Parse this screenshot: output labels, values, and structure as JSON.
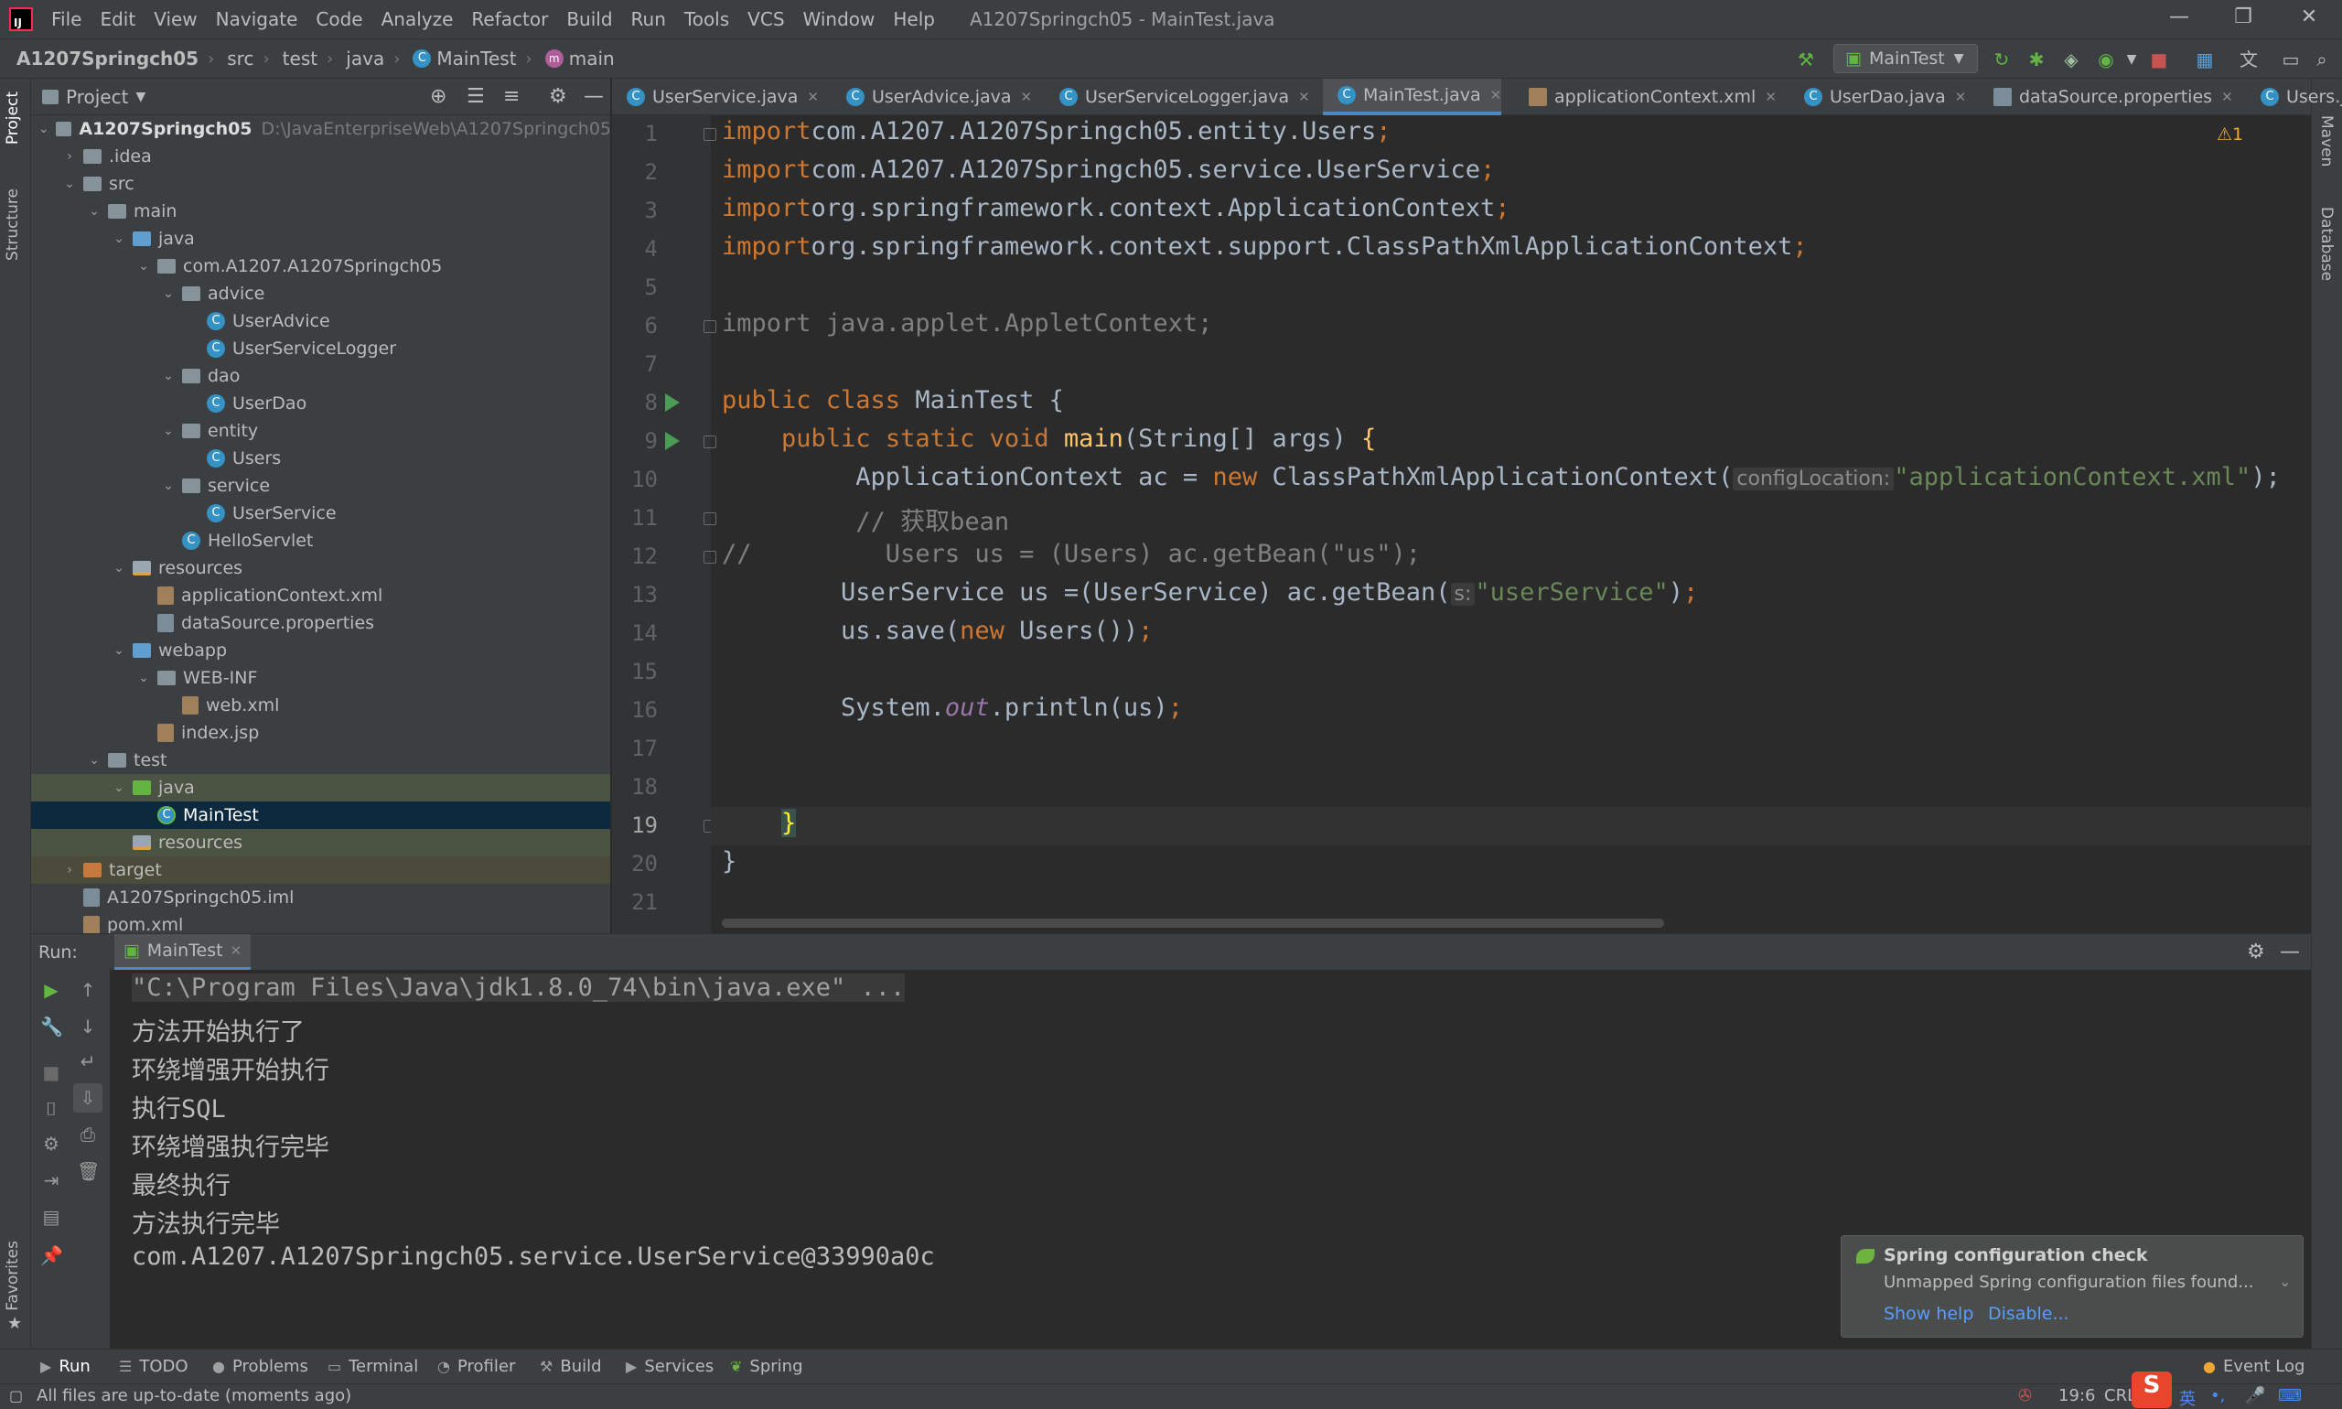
{
  "window": {
    "title": "A1207Springch05 - MainTest.java",
    "menus": [
      "File",
      "Edit",
      "View",
      "Navigate",
      "Code",
      "Analyze",
      "Refactor",
      "Build",
      "Run",
      "Tools",
      "VCS",
      "Window",
      "Help"
    ],
    "controls": {
      "minimize": "—",
      "maximize": "❐",
      "close": "✕"
    }
  },
  "breadcrumb": {
    "project": "A1207Springch05",
    "parts": [
      "src",
      "test",
      "java"
    ],
    "class": "MainTest",
    "method": "main"
  },
  "toolbar": {
    "run_config": "MainTest",
    "icons": [
      "hammer-icon",
      "run-icon",
      "debug-icon",
      "coverage-icon",
      "profile-icon",
      "stop-icon",
      "project-structure-icon",
      "translate-icon",
      "layout-icon",
      "search-icon"
    ]
  },
  "side_tabs": {
    "project": "Project",
    "structure": "Structure",
    "favorites": "Favorites",
    "maven": "Maven",
    "database": "Database"
  },
  "project": {
    "header": "Project",
    "root_name": "A1207Springch05",
    "root_path": "D:\\JavaEnterpriseWeb\\A1207Springch05",
    "tree": [
      {
        "label": ".idea",
        "depth": 1,
        "kind": "folder",
        "arrow": "›"
      },
      {
        "label": "src",
        "depth": 1,
        "kind": "folder",
        "arrow": "⌄"
      },
      {
        "label": "main",
        "depth": 2,
        "kind": "folder",
        "arrow": "⌄"
      },
      {
        "label": "java",
        "depth": 3,
        "kind": "folder-blue",
        "arrow": "⌄"
      },
      {
        "label": "com.A1207.A1207Springch05",
        "depth": 4,
        "kind": "folder",
        "arrow": "⌄"
      },
      {
        "label": "advice",
        "depth": 5,
        "kind": "folder",
        "arrow": "⌄"
      },
      {
        "label": "UserAdvice",
        "depth": 6,
        "kind": "class",
        "arrow": ""
      },
      {
        "label": "UserServiceLogger",
        "depth": 6,
        "kind": "class",
        "arrow": ""
      },
      {
        "label": "dao",
        "depth": 5,
        "kind": "folder",
        "arrow": "⌄"
      },
      {
        "label": "UserDao",
        "depth": 6,
        "kind": "class",
        "arrow": ""
      },
      {
        "label": "entity",
        "depth": 5,
        "kind": "folder",
        "arrow": "⌄"
      },
      {
        "label": "Users",
        "depth": 6,
        "kind": "class",
        "arrow": ""
      },
      {
        "label": "service",
        "depth": 5,
        "kind": "folder",
        "arrow": "⌄"
      },
      {
        "label": "UserService",
        "depth": 6,
        "kind": "class",
        "arrow": ""
      },
      {
        "label": "HelloServlet",
        "depth": 5,
        "kind": "class",
        "arrow": ""
      },
      {
        "label": "resources",
        "depth": 3,
        "kind": "folder-res",
        "arrow": "⌄"
      },
      {
        "label": "applicationContext.xml",
        "depth": 4,
        "kind": "xml",
        "arrow": ""
      },
      {
        "label": "dataSource.properties",
        "depth": 4,
        "kind": "prop",
        "arrow": ""
      },
      {
        "label": "webapp",
        "depth": 3,
        "kind": "folder-blue",
        "arrow": "⌄"
      },
      {
        "label": "WEB-INF",
        "depth": 4,
        "kind": "folder",
        "arrow": "⌄"
      },
      {
        "label": "web.xml",
        "depth": 5,
        "kind": "xml",
        "arrow": ""
      },
      {
        "label": "index.jsp",
        "depth": 4,
        "kind": "xml",
        "arrow": ""
      },
      {
        "label": "test",
        "depth": 2,
        "kind": "folder",
        "arrow": "⌄"
      },
      {
        "label": "java",
        "depth": 3,
        "kind": "folder-green",
        "arrow": "⌄"
      },
      {
        "label": "MainTest",
        "depth": 4,
        "kind": "class-test",
        "arrow": ""
      },
      {
        "label": "resources",
        "depth": 3,
        "kind": "folder-res",
        "arrow": ""
      },
      {
        "label": "target",
        "depth": 1,
        "kind": "folder-orange",
        "arrow": "›"
      },
      {
        "label": "A1207Springch05.iml",
        "depth": 1,
        "kind": "prop",
        "arrow": ""
      },
      {
        "label": "pom.xml",
        "depth": 1,
        "kind": "xml",
        "arrow": ""
      }
    ]
  },
  "tabs": [
    {
      "label": "UserService.java",
      "kind": "class"
    },
    {
      "label": "UserAdvice.java",
      "kind": "class"
    },
    {
      "label": "UserServiceLogger.java",
      "kind": "class"
    },
    {
      "label": "MainTest.java",
      "kind": "class"
    },
    {
      "label": "applicationContext.xml",
      "kind": "xml"
    },
    {
      "label": "UserDao.java",
      "kind": "class"
    },
    {
      "label": "dataSource.properties",
      "kind": "prop"
    },
    {
      "label": "Users.java",
      "kind": "class"
    }
  ],
  "editor": {
    "warnings": "⚠1",
    "current_line": 19,
    "lines": [
      [
        [
          "kw",
          "import"
        ],
        [
          "",
          "com.A1207.A1207Springch05.entity.Users"
        ],
        [
          "kw",
          ";"
        ]
      ],
      [
        [
          "kw",
          "import"
        ],
        [
          "",
          "com.A1207.A1207Springch05.service.UserService"
        ],
        [
          "kw",
          ";"
        ]
      ],
      [
        [
          "kw",
          "import"
        ],
        [
          "",
          "org.springframework.context.ApplicationContext"
        ],
        [
          "kw",
          ";"
        ]
      ],
      [
        [
          "kw",
          "import"
        ],
        [
          "",
          "org.springframework.context.support.ClassPathXmlApplicationContext"
        ],
        [
          "kw",
          ";"
        ]
      ],
      [],
      [
        [
          "dim",
          "import java.applet.AppletContext;"
        ]
      ],
      [],
      [
        [
          "kw",
          "public class "
        ],
        [
          "",
          "MainTest {"
        ]
      ],
      [
        [
          "",
          "    "
        ],
        [
          "kw",
          "public static void "
        ],
        [
          "mth",
          "main"
        ],
        [
          "",
          "(String[] args) "
        ],
        [
          "mth",
          "{"
        ]
      ],
      [
        [
          "",
          "         ApplicationContext ac = "
        ],
        [
          "kw",
          "new "
        ],
        [
          "",
          "ClassPathXmlApplicationContext("
        ],
        [
          "hint",
          "configLocation:"
        ],
        [
          "str",
          "\"applicationContext.xml\""
        ],
        [
          "",
          "); "
        ]
      ],
      [
        [
          "",
          "         "
        ],
        [
          "cmt",
          "// 获取bean"
        ]
      ],
      [
        [
          "cmt",
          "//         Users us = (Users) ac.getBean(\"us\");"
        ]
      ],
      [
        [
          "",
          "        UserService us =(UserService) ac.getBean("
        ],
        [
          "hint",
          "s:"
        ],
        [
          "str",
          "\"userService\""
        ],
        [
          "",
          ")"
        ],
        [
          "kw",
          ";"
        ]
      ],
      [
        [
          "",
          "        us.save("
        ],
        [
          "kw",
          "new "
        ],
        [
          "",
          "Users())"
        ],
        [
          "kw",
          ";"
        ]
      ],
      [],
      [
        [
          "",
          "        System."
        ],
        [
          "fld",
          "out"
        ],
        [
          "",
          ".println(us)"
        ],
        [
          "kw",
          ";"
        ]
      ],
      [],
      [],
      [
        [
          "",
          "    "
        ],
        [
          "brace",
          "}"
        ]
      ],
      [
        [
          "",
          "}"
        ]
      ],
      []
    ]
  },
  "run": {
    "label": "Run:",
    "tab": "MainTest",
    "output": [
      "\"C:\\Program Files\\Java\\jdk1.8.0_74\\bin\\java.exe\" ...",
      "方法开始执行了",
      "环绕增强开始执行",
      "执行SQL",
      "环绕增强执行完毕",
      "最终执行",
      "方法执行完毕",
      "com.A1207.A1207Springch05.service.UserService@33990a0c"
    ]
  },
  "notification": {
    "title": "Spring configuration check",
    "body": "Unmapped Spring configuration files found...",
    "link_help": "Show help",
    "link_disable": "Disable..."
  },
  "bottom_tools": [
    "Run",
    "TODO",
    "Problems",
    "Terminal",
    "Profiler",
    "Build",
    "Services",
    "Spring"
  ],
  "event_log": "Event Log",
  "status": {
    "message": "All files are up-to-date (moments ago)",
    "position": "19:6",
    "line_sep": "CRL",
    "ime": "英"
  }
}
